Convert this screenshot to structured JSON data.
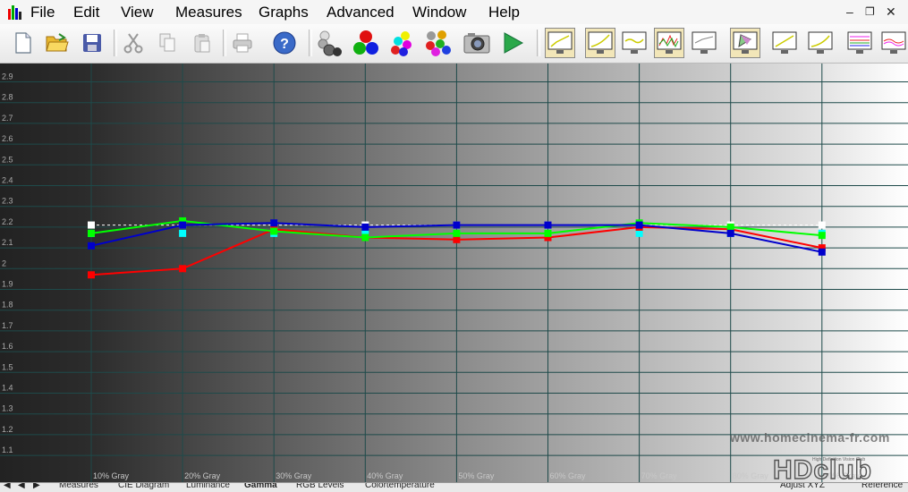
{
  "menu": {
    "items": [
      "File",
      "Edit",
      "View",
      "Measures",
      "Graphs",
      "Advanced",
      "Window",
      "Help"
    ],
    "underline": [
      "F",
      "E",
      "V",
      "M",
      "G",
      "A",
      "W",
      "H"
    ]
  },
  "window_controls": {
    "minimize": "–",
    "restore": "❐",
    "close": "✕"
  },
  "toolbar": {
    "icons": [
      "new-document-icon",
      "open-folder-icon",
      "save-disk-icon",
      "cut-icon",
      "copy-icon",
      "paste-icon",
      "print-icon",
      "help-icon",
      "grayscale-balls-icon",
      "rgb-balls-icon",
      "secondary-colors-icon",
      "all-colors-icon",
      "camera-icon",
      "play-icon",
      "luminance-graph-icon",
      "gamma-graph-icon",
      "rgb-levels-graph-icon",
      "spectrum-graph-icon",
      "color-temperature-graph-icon",
      "cie-diagram-icon",
      "contrast-graph-icon",
      "near-black-graph-icon",
      "rgb-histogram-icon",
      "saturation-graph-icon"
    ]
  },
  "chart_data": {
    "type": "line",
    "ylabel_ticks": [
      "2.9",
      "2.8",
      "2.7",
      "2.6",
      "2.5",
      "2.4",
      "2.3",
      "2.2",
      "2.1",
      "2",
      "1.9",
      "1.8",
      "1.7",
      "1.6",
      "1.5",
      "1.4",
      "1.3",
      "1.2",
      "1.1"
    ],
    "ylim": [
      1.05,
      2.95
    ],
    "categories": [
      "10% Gray",
      "20% Gray",
      "30% Gray",
      "40% Gray",
      "50% Gray",
      "60% Gray",
      "70% Gray",
      "80% Gray",
      "90% Gray"
    ],
    "grid": true,
    "series": [
      {
        "color": "#ff0000",
        "values": [
          1.97,
          2.0,
          2.19,
          2.15,
          2.14,
          2.15,
          2.2,
          2.19,
          2.1
        ]
      },
      {
        "color": "#00ff00",
        "values": [
          2.17,
          2.23,
          2.18,
          2.15,
          2.17,
          2.17,
          2.22,
          2.2,
          2.16
        ]
      },
      {
        "color": "#0000cc",
        "values": [
          2.11,
          2.21,
          2.22,
          2.2,
          2.21,
          2.21,
          2.21,
          2.17,
          2.08
        ]
      },
      {
        "color": "#00ffff",
        "values": [
          2.17,
          2.17,
          2.17,
          2.17,
          2.17,
          2.17,
          2.17,
          2.17,
          2.17
        ],
        "marker_only": true
      },
      {
        "color": "#ffffff",
        "values": [
          2.21,
          2.21,
          2.21,
          2.21,
          2.21,
          2.21,
          2.21,
          2.21,
          2.21
        ],
        "dashed": true
      }
    ]
  },
  "tabs": [
    "Measures",
    "CIE Diagram",
    "Luminance",
    "Gamma",
    "RGB Levels",
    "Colortemperature"
  ],
  "nav_arrows": [
    "◀",
    "◀",
    "▶"
  ],
  "watermark": "www.homecinema-fr.com",
  "hdclub": {
    "text": "HDclub",
    "sub": "High Definition Vision Club"
  },
  "status": {
    "adjust": "Adjust XYZ",
    "reference": "Reference"
  }
}
